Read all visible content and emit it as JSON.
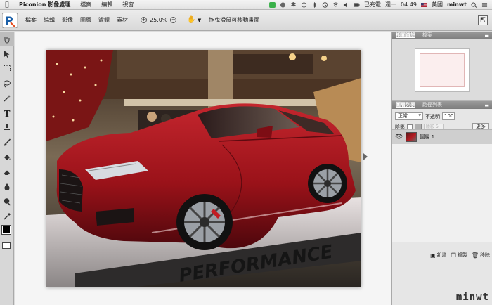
{
  "menubar": {
    "apple_icon": "apple-logo",
    "app_name": "Piconion 影像處理",
    "items": [
      "檔案",
      "編輯",
      "視窗"
    ],
    "status": {
      "charge": "已充電",
      "day": "週一",
      "time": "04:49",
      "flag_label": "美國",
      "user": "minwt"
    }
  },
  "toolbar": {
    "menus": [
      "檔案",
      "編輯",
      "影像",
      "圖層",
      "濾鏡",
      "素材"
    ],
    "zoom_in_icon": "plus-circle-icon",
    "zoom_value": "25.0%",
    "zoom_out_icon": "minus-circle-icon",
    "hand_hint": "拖曳滑鼠可移動畫面"
  },
  "tools": [
    "hand-tool",
    "move-tool",
    "marquee-tool",
    "lasso-tool",
    "magic-wand-tool",
    "text-tool",
    "stamp-tool",
    "brush-tool",
    "fill-tool",
    "eraser-tool",
    "blur-tool",
    "dodge-tool",
    "eyedropper-tool"
  ],
  "panel": {
    "nav_tabs": [
      "相關資訊",
      "檔案"
    ],
    "layer_tabs": [
      "圖層列表",
      "路徑列表"
    ],
    "blend_mode": "正常",
    "opacity_label": "不透明",
    "opacity_value": "100",
    "shadow_label": "陰影",
    "shadow_field": "陰影",
    "shadow_num": "5",
    "more_label": "更多",
    "layers": [
      {
        "name": "圖層 1"
      }
    ],
    "footer": {
      "new_label": "新增",
      "copy_label": "複製",
      "delete_label": "移除"
    }
  },
  "photo": {
    "banner_text": "PERFORMANCE"
  },
  "watermark": "minwt"
}
